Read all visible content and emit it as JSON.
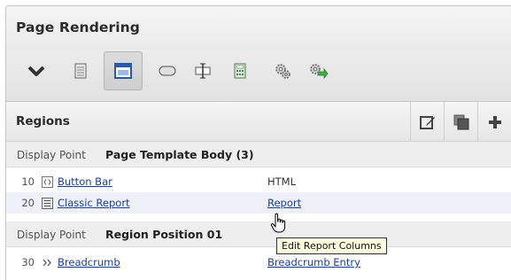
{
  "panel": {
    "title": "Page Rendering",
    "toolbar": [
      {
        "icon": "chevron-down-icon"
      },
      {
        "icon": "page-icon"
      },
      {
        "icon": "region-icon",
        "active": true
      },
      {
        "icon": "button-icon"
      },
      {
        "icon": "item-icon"
      },
      {
        "icon": "calculator-icon"
      },
      {
        "icon": "gears-icon"
      },
      {
        "icon": "gear-arrow-icon"
      }
    ]
  },
  "regions": {
    "title": "Regions",
    "actions": [
      {
        "icon": "edit-icon"
      },
      {
        "icon": "copy-icon"
      },
      {
        "icon": "add-icon"
      }
    ]
  },
  "groups": [
    {
      "label": "Display Point",
      "name": "Page Template Body (3)",
      "items": [
        {
          "seq": "10",
          "icon": "button-bar-icon",
          "name": "Button Bar",
          "type": "HTML",
          "type_is_link": false
        },
        {
          "seq": "20",
          "icon": "report-icon",
          "name": "Classic Report",
          "type": "Report",
          "type_is_link": true
        }
      ]
    },
    {
      "label": "Display Point",
      "name": "Region Position 01",
      "items": [
        {
          "seq": "30",
          "icon": "breadcrumb-icon",
          "name": "Breadcrumb",
          "type": "Breadcrumb Entry",
          "type_is_link": true
        }
      ]
    }
  ],
  "tooltip": "Edit Report Columns",
  "colors": {
    "link": "#1c3f95",
    "header_bg": "#e8e8e8",
    "group_bg": "#eeeeee"
  }
}
